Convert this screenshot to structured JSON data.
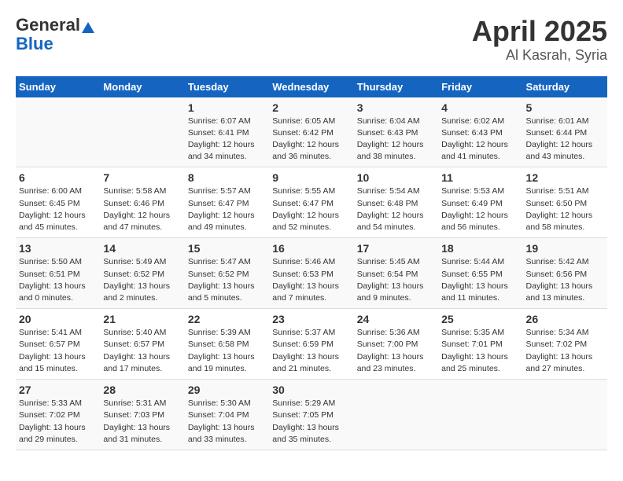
{
  "header": {
    "logo_general": "General",
    "logo_blue": "Blue",
    "title": "April 2025",
    "subtitle": "Al Kasrah, Syria"
  },
  "days_of_week": [
    "Sunday",
    "Monday",
    "Tuesday",
    "Wednesday",
    "Thursday",
    "Friday",
    "Saturday"
  ],
  "weeks": [
    [
      {
        "day": "",
        "info": ""
      },
      {
        "day": "",
        "info": ""
      },
      {
        "day": "1",
        "info": "Sunrise: 6:07 AM\nSunset: 6:41 PM\nDaylight: 12 hours\nand 34 minutes."
      },
      {
        "day": "2",
        "info": "Sunrise: 6:05 AM\nSunset: 6:42 PM\nDaylight: 12 hours\nand 36 minutes."
      },
      {
        "day": "3",
        "info": "Sunrise: 6:04 AM\nSunset: 6:43 PM\nDaylight: 12 hours\nand 38 minutes."
      },
      {
        "day": "4",
        "info": "Sunrise: 6:02 AM\nSunset: 6:43 PM\nDaylight: 12 hours\nand 41 minutes."
      },
      {
        "day": "5",
        "info": "Sunrise: 6:01 AM\nSunset: 6:44 PM\nDaylight: 12 hours\nand 43 minutes."
      }
    ],
    [
      {
        "day": "6",
        "info": "Sunrise: 6:00 AM\nSunset: 6:45 PM\nDaylight: 12 hours\nand 45 minutes."
      },
      {
        "day": "7",
        "info": "Sunrise: 5:58 AM\nSunset: 6:46 PM\nDaylight: 12 hours\nand 47 minutes."
      },
      {
        "day": "8",
        "info": "Sunrise: 5:57 AM\nSunset: 6:47 PM\nDaylight: 12 hours\nand 49 minutes."
      },
      {
        "day": "9",
        "info": "Sunrise: 5:55 AM\nSunset: 6:47 PM\nDaylight: 12 hours\nand 52 minutes."
      },
      {
        "day": "10",
        "info": "Sunrise: 5:54 AM\nSunset: 6:48 PM\nDaylight: 12 hours\nand 54 minutes."
      },
      {
        "day": "11",
        "info": "Sunrise: 5:53 AM\nSunset: 6:49 PM\nDaylight: 12 hours\nand 56 minutes."
      },
      {
        "day": "12",
        "info": "Sunrise: 5:51 AM\nSunset: 6:50 PM\nDaylight: 12 hours\nand 58 minutes."
      }
    ],
    [
      {
        "day": "13",
        "info": "Sunrise: 5:50 AM\nSunset: 6:51 PM\nDaylight: 13 hours\nand 0 minutes."
      },
      {
        "day": "14",
        "info": "Sunrise: 5:49 AM\nSunset: 6:52 PM\nDaylight: 13 hours\nand 2 minutes."
      },
      {
        "day": "15",
        "info": "Sunrise: 5:47 AM\nSunset: 6:52 PM\nDaylight: 13 hours\nand 5 minutes."
      },
      {
        "day": "16",
        "info": "Sunrise: 5:46 AM\nSunset: 6:53 PM\nDaylight: 13 hours\nand 7 minutes."
      },
      {
        "day": "17",
        "info": "Sunrise: 5:45 AM\nSunset: 6:54 PM\nDaylight: 13 hours\nand 9 minutes."
      },
      {
        "day": "18",
        "info": "Sunrise: 5:44 AM\nSunset: 6:55 PM\nDaylight: 13 hours\nand 11 minutes."
      },
      {
        "day": "19",
        "info": "Sunrise: 5:42 AM\nSunset: 6:56 PM\nDaylight: 13 hours\nand 13 minutes."
      }
    ],
    [
      {
        "day": "20",
        "info": "Sunrise: 5:41 AM\nSunset: 6:57 PM\nDaylight: 13 hours\nand 15 minutes."
      },
      {
        "day": "21",
        "info": "Sunrise: 5:40 AM\nSunset: 6:57 PM\nDaylight: 13 hours\nand 17 minutes."
      },
      {
        "day": "22",
        "info": "Sunrise: 5:39 AM\nSunset: 6:58 PM\nDaylight: 13 hours\nand 19 minutes."
      },
      {
        "day": "23",
        "info": "Sunrise: 5:37 AM\nSunset: 6:59 PM\nDaylight: 13 hours\nand 21 minutes."
      },
      {
        "day": "24",
        "info": "Sunrise: 5:36 AM\nSunset: 7:00 PM\nDaylight: 13 hours\nand 23 minutes."
      },
      {
        "day": "25",
        "info": "Sunrise: 5:35 AM\nSunset: 7:01 PM\nDaylight: 13 hours\nand 25 minutes."
      },
      {
        "day": "26",
        "info": "Sunrise: 5:34 AM\nSunset: 7:02 PM\nDaylight: 13 hours\nand 27 minutes."
      }
    ],
    [
      {
        "day": "27",
        "info": "Sunrise: 5:33 AM\nSunset: 7:02 PM\nDaylight: 13 hours\nand 29 minutes."
      },
      {
        "day": "28",
        "info": "Sunrise: 5:31 AM\nSunset: 7:03 PM\nDaylight: 13 hours\nand 31 minutes."
      },
      {
        "day": "29",
        "info": "Sunrise: 5:30 AM\nSunset: 7:04 PM\nDaylight: 13 hours\nand 33 minutes."
      },
      {
        "day": "30",
        "info": "Sunrise: 5:29 AM\nSunset: 7:05 PM\nDaylight: 13 hours\nand 35 minutes."
      },
      {
        "day": "",
        "info": ""
      },
      {
        "day": "",
        "info": ""
      },
      {
        "day": "",
        "info": ""
      }
    ]
  ]
}
